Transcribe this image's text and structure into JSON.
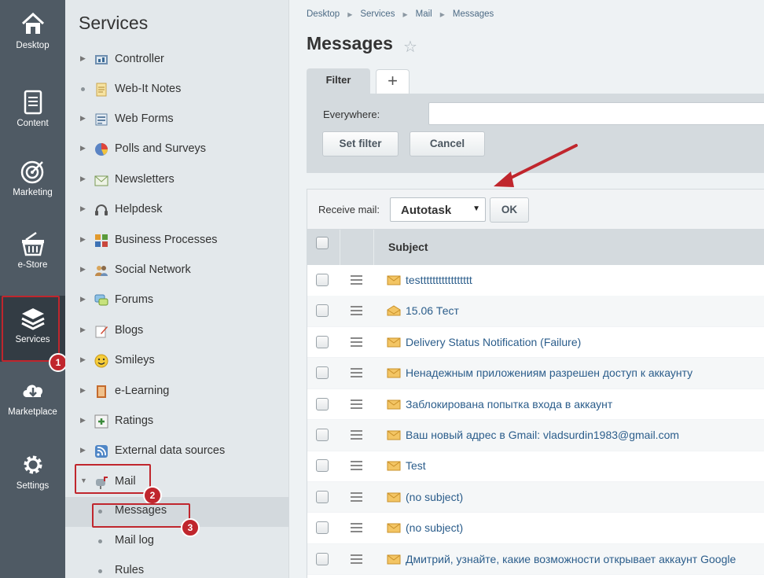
{
  "rail": {
    "items": [
      {
        "label": "Desktop",
        "icon": "home-icon"
      },
      {
        "label": "Content",
        "icon": "document-icon"
      },
      {
        "label": "Marketing",
        "icon": "target-icon"
      },
      {
        "label": "e-Store",
        "icon": "basket-icon"
      },
      {
        "label": "Services",
        "icon": "layers-icon"
      },
      {
        "label": "Marketplace",
        "icon": "cloud-download-icon"
      },
      {
        "label": "Settings",
        "icon": "gear-icon"
      }
    ]
  },
  "menu": {
    "title": "Services",
    "items": [
      {
        "label": "Controller"
      },
      {
        "label": "Web-It Notes"
      },
      {
        "label": "Web Forms"
      },
      {
        "label": "Polls and Surveys"
      },
      {
        "label": "Newsletters"
      },
      {
        "label": "Helpdesk"
      },
      {
        "label": "Business Processes"
      },
      {
        "label": "Social Network"
      },
      {
        "label": "Forums"
      },
      {
        "label": "Blogs"
      },
      {
        "label": "Smileys"
      },
      {
        "label": "e-Learning"
      },
      {
        "label": "Ratings"
      },
      {
        "label": "External data sources"
      },
      {
        "label": "Mail"
      }
    ],
    "mail_sub": [
      {
        "label": "Messages"
      },
      {
        "label": "Mail log"
      },
      {
        "label": "Rules"
      }
    ]
  },
  "annotations": {
    "badge1": "1",
    "badge2": "2",
    "badge3": "3"
  },
  "breadcrumb": [
    "Desktop",
    "Services",
    "Mail",
    "Messages"
  ],
  "page": {
    "title": "Messages"
  },
  "filter": {
    "tab_label": "Filter",
    "add_tab": "+",
    "field_label": "Everywhere:",
    "field_value": "",
    "set_label": "Set filter",
    "cancel_label": "Cancel"
  },
  "toolbar": {
    "receive_label": "Receive mail:",
    "mailbox_selected": "Autotask",
    "ok_label": "OK"
  },
  "grid": {
    "column_subject": "Subject",
    "rows": [
      {
        "subject": "testtttttttttttttttt",
        "read": false
      },
      {
        "subject": "15.06 Тест",
        "read": true
      },
      {
        "subject": "Delivery Status Notification (Failure)",
        "read": false
      },
      {
        "subject": "Ненадежным приложениям разрешен доступ к аккаунту",
        "read": false
      },
      {
        "subject": "Заблокирована попытка входа в аккаунт",
        "read": false
      },
      {
        "subject": "Ваш новый адрес в Gmail: vladsurdin1983@gmail.com",
        "read": false
      },
      {
        "subject": "Test",
        "read": false
      },
      {
        "subject": "(no subject)",
        "read": false
      },
      {
        "subject": "(no subject)",
        "read": false
      },
      {
        "subject": "Дмитрий, узнайте, какие возможности открывает аккаунт Google",
        "read": false
      }
    ]
  },
  "colors": {
    "rail_bg": "#4f5a64",
    "highlight_red": "#c0262d",
    "link_blue": "#2b5d8b"
  }
}
